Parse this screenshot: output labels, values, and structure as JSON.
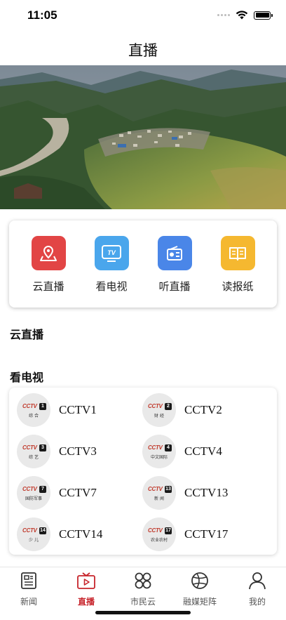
{
  "status": {
    "time": "11:05"
  },
  "header": {
    "title": "直播"
  },
  "colors": {
    "accent": "#c7242b",
    "cloud": "#e24545",
    "tv": "#4aa6ec",
    "radio": "#4a86e8",
    "paper": "#f5b830"
  },
  "services": [
    {
      "label": "云直播",
      "icon": "location-pin-icon",
      "color": "#e24545"
    },
    {
      "label": "看电视",
      "icon": "tv-icon",
      "color": "#4aa6ec",
      "icon_text": "TV"
    },
    {
      "label": "听直播",
      "icon": "radio-icon",
      "color": "#4a86e8"
    },
    {
      "label": "读报纸",
      "icon": "book-icon",
      "color": "#f5b830"
    }
  ],
  "sections": {
    "cloud_live": "云直播",
    "watch_tv": "看电视"
  },
  "channels": [
    {
      "name": "CCTV1",
      "logo_text": "CCTV",
      "logo_num": "1",
      "logo_sub": "综 合"
    },
    {
      "name": "CCTV2",
      "logo_text": "CCTV",
      "logo_num": "2",
      "logo_sub": "财 经"
    },
    {
      "name": "CCTV3",
      "logo_text": "CCTV",
      "logo_num": "3",
      "logo_sub": "综 艺"
    },
    {
      "name": "CCTV4",
      "logo_text": "CCTV",
      "logo_num": "4",
      "logo_sub": "中文国际"
    },
    {
      "name": "CCTV7",
      "logo_text": "CCTV",
      "logo_num": "7",
      "logo_sub": "国防军事"
    },
    {
      "name": "CCTV13",
      "logo_text": "CCTV",
      "logo_num": "13",
      "logo_sub": "新 闻"
    },
    {
      "name": "CCTV14",
      "logo_text": "CCTV",
      "logo_num": "14",
      "logo_sub": "少 儿"
    },
    {
      "name": "CCTV17",
      "logo_text": "CCTV",
      "logo_num": "17",
      "logo_sub": "农业农村"
    }
  ],
  "tabs": [
    {
      "label": "新闻",
      "icon": "news-icon",
      "active": false
    },
    {
      "label": "直播",
      "icon": "live-tv-icon",
      "active": true
    },
    {
      "label": "市民云",
      "icon": "grid-icon",
      "active": false
    },
    {
      "label": "融媒矩阵",
      "icon": "matrix-icon",
      "active": false
    },
    {
      "label": "我的",
      "icon": "user-icon",
      "active": false
    }
  ]
}
